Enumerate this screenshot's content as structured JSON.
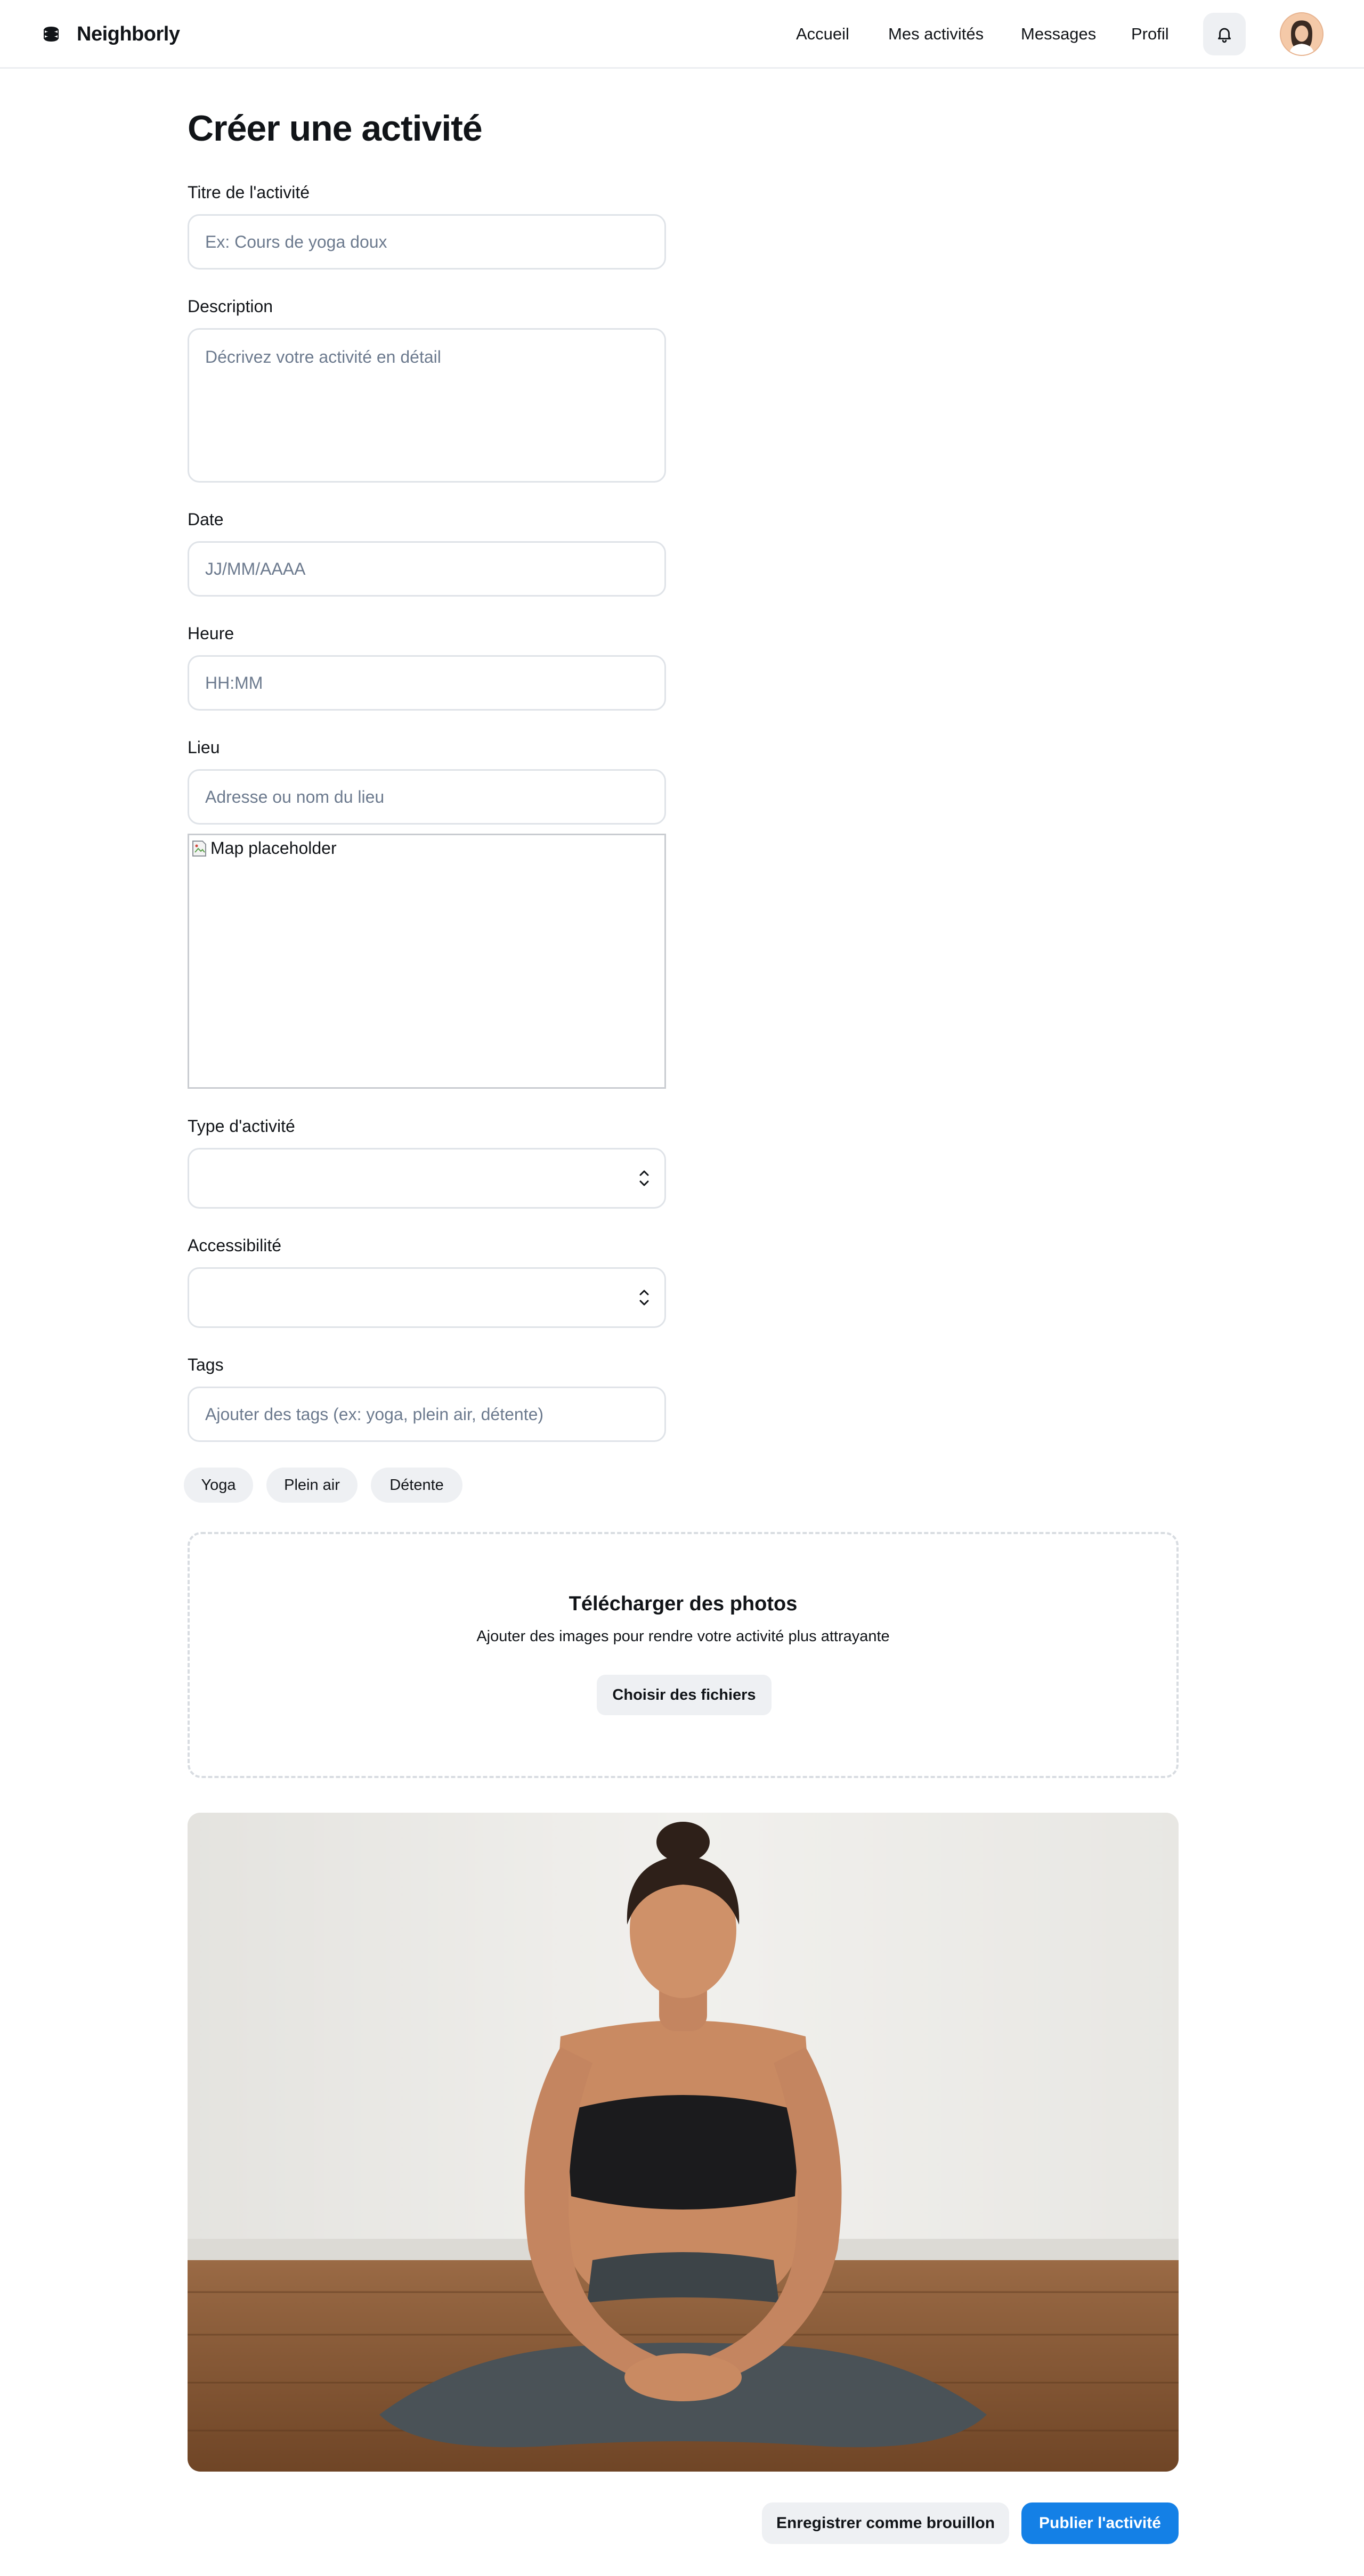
{
  "header": {
    "brand": "Neighborly",
    "nav": [
      "Accueil",
      "Mes activités",
      "Messages",
      "Profil"
    ],
    "icons": {
      "brand": "neighborly-logo-icon",
      "notifications": "bell-icon",
      "avatar": "user-avatar"
    }
  },
  "form": {
    "title": "Créer une activité",
    "activity_title": {
      "label": "Titre de l'activité",
      "placeholder": "Ex: Cours de yoga doux",
      "value": ""
    },
    "description": {
      "label": "Description",
      "placeholder": "Décrivez votre activité en détail",
      "value": ""
    },
    "date": {
      "label": "Date",
      "placeholder": "JJ/MM/AAAA",
      "value": ""
    },
    "time": {
      "label": "Heure",
      "placeholder": "HH:MM",
      "value": ""
    },
    "location": {
      "label": "Lieu",
      "placeholder": "Adresse ou nom du lieu",
      "value": "",
      "map_alt": "Map placeholder"
    },
    "activity_type": {
      "label": "Type d'activité",
      "value": ""
    },
    "accessibility": {
      "label": "Accessibilité",
      "value": ""
    },
    "tags": {
      "label": "Tags",
      "placeholder": "Ajouter des tags (ex: yoga, plein air, détente)",
      "chips": [
        "Yoga",
        "Plein air",
        "Détente"
      ]
    }
  },
  "upload": {
    "title": "Télécharger des photos",
    "subtitle": "Ajouter des images pour rendre votre activité plus attrayante",
    "button": "Choisir des fichiers"
  },
  "actions": {
    "draft": "Enregistrer comme brouillon",
    "publish": "Publier l'activité"
  },
  "colors": {
    "primary": "#1480e6",
    "secondary_button": "#eef0f3",
    "border": "#dfe3e8",
    "placeholder": "#6c7a8e"
  }
}
